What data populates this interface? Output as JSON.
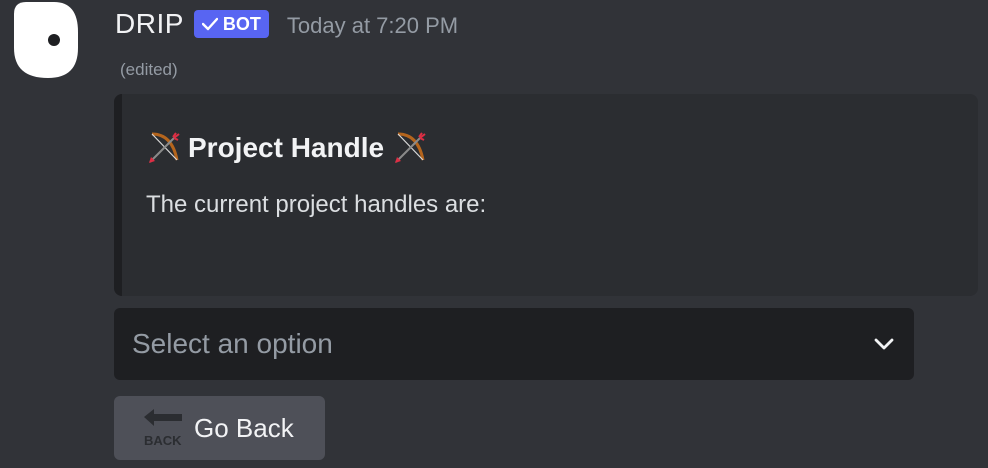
{
  "message": {
    "username": "DRIP",
    "bot_badge": "BOT",
    "timestamp": "Today at 7:20 PM",
    "edited_label": "(edited)"
  },
  "embed": {
    "title": "Project Handle",
    "title_emoji": "bow-and-arrow-icon",
    "description": "The current project handles are:"
  },
  "select": {
    "placeholder": "Select an option"
  },
  "back_button": {
    "label": "Go Back",
    "icon_text": "BACK"
  },
  "colors": {
    "background": "#313338",
    "embed_background": "#2b2d31",
    "bot_badge": "#5865f2",
    "button": "#4e5058",
    "select_background": "#1e1f22"
  }
}
